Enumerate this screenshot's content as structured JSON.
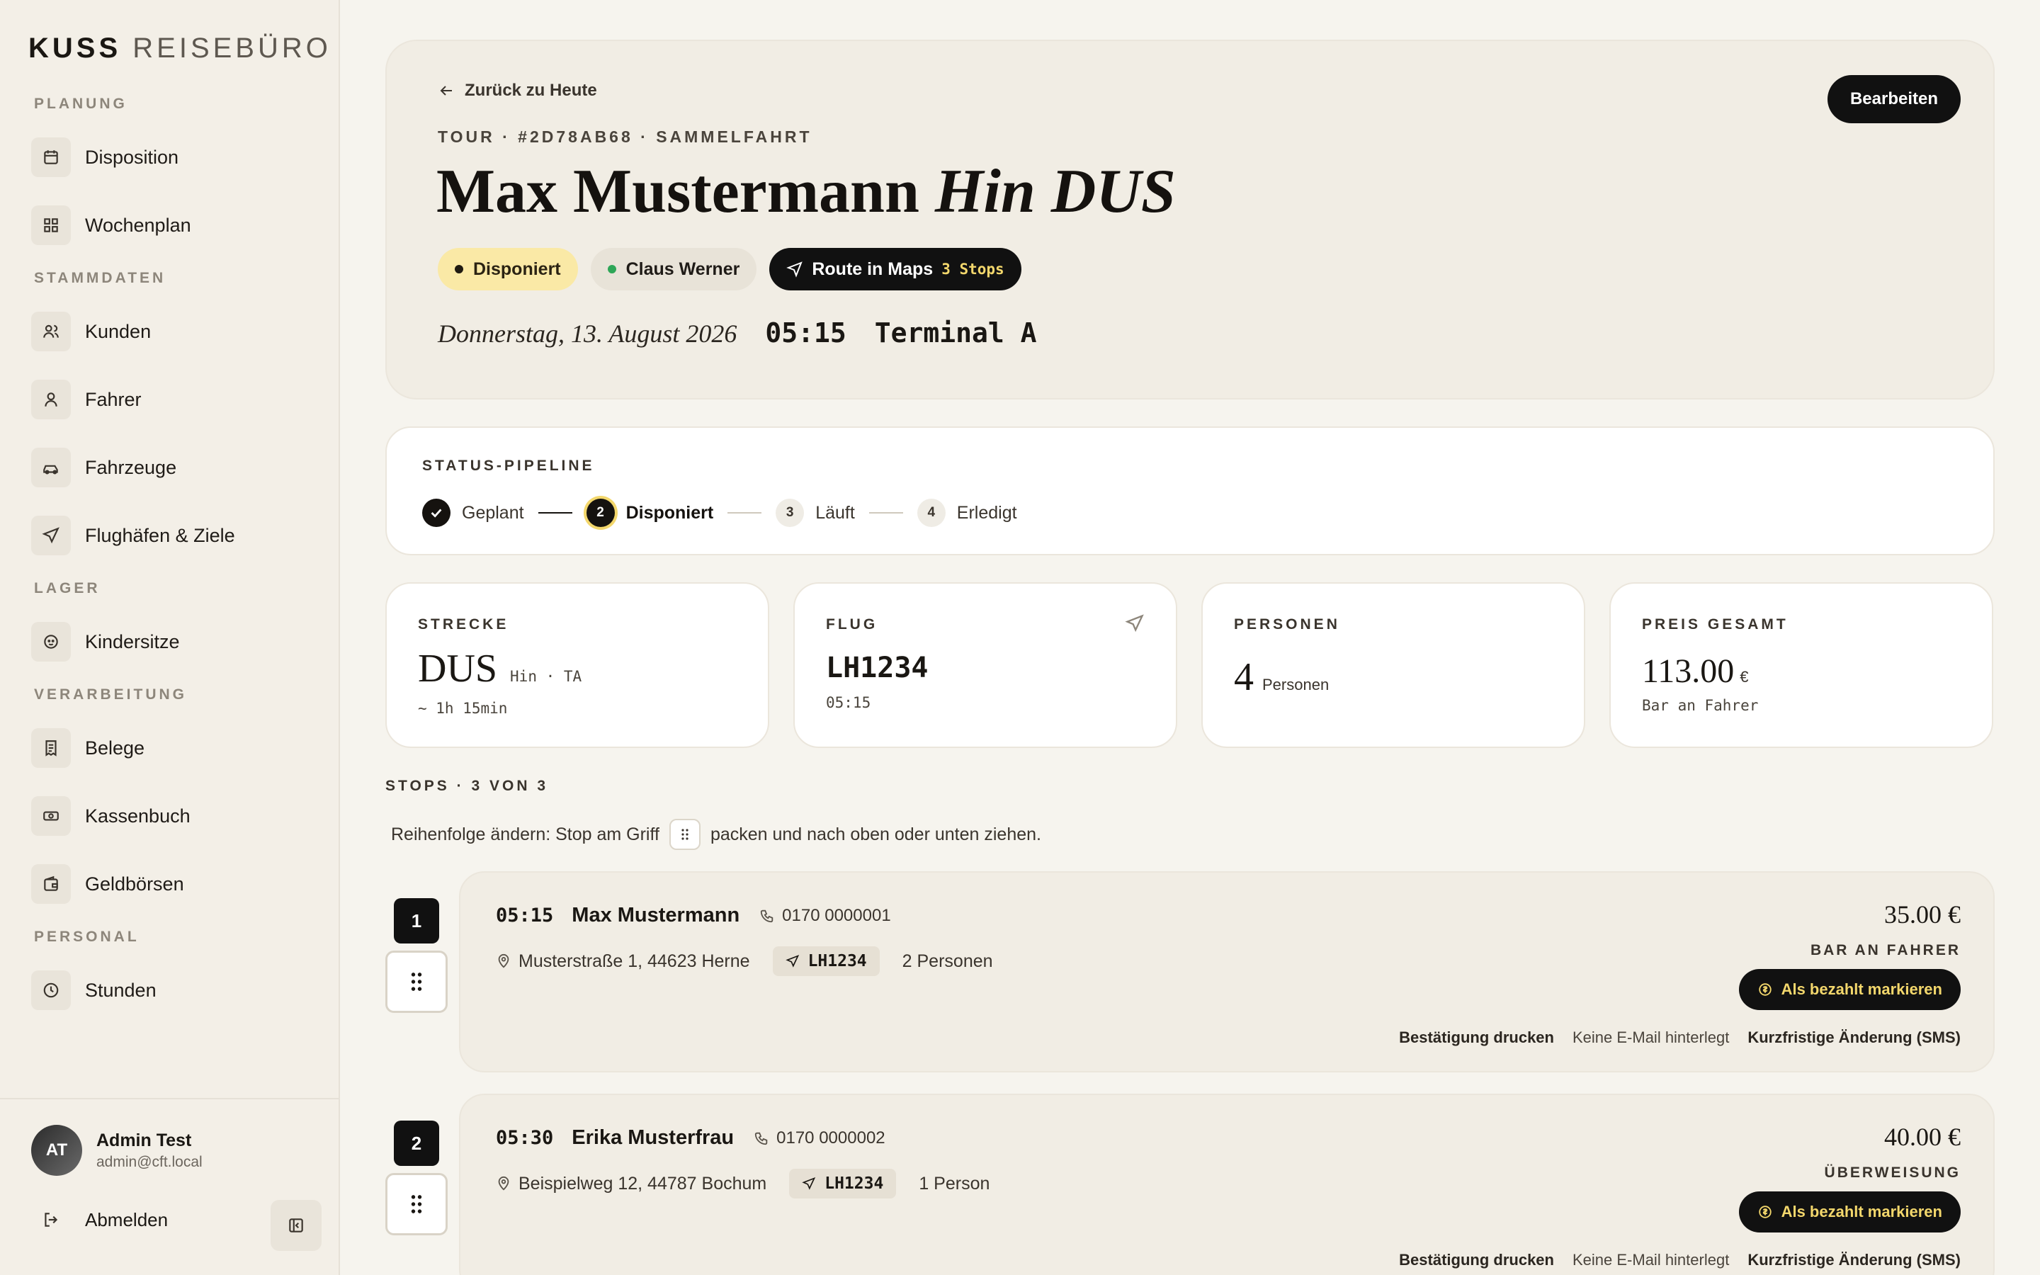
{
  "brand": {
    "bold": "KUSS",
    "light": "REISEBÜRO"
  },
  "sidebar": {
    "sections": [
      {
        "label": "PLANUNG",
        "items": [
          "Disposition",
          "Wochenplan"
        ]
      },
      {
        "label": "STAMMDATEN",
        "items": [
          "Kunden",
          "Fahrer",
          "Fahrzeuge",
          "Flughäfen & Ziele"
        ]
      },
      {
        "label": "LAGER",
        "items": [
          "Kindersitze"
        ]
      },
      {
        "label": "VERARBEITUNG",
        "items": [
          "Belege",
          "Kassenbuch",
          "Geldbörsen"
        ]
      },
      {
        "label": "PERSONAL",
        "items": [
          "Stunden"
        ]
      }
    ],
    "user": {
      "initials": "AT",
      "name": "Admin Test",
      "email": "admin@cft.local"
    },
    "logout": "Abmelden"
  },
  "hero": {
    "back": "Zurück zu Heute",
    "meta": "TOUR · #2D78AB68 · SAMMELFAHRT",
    "title_main": "Max Mustermann",
    "title_italic": "Hin DUS",
    "status_chip": "Disponiert",
    "driver_chip": "Claus Werner",
    "route_chip": "Route in Maps",
    "route_stops": "3 Stops",
    "date": "Donnerstag, 13. August 2026",
    "time": "05:15",
    "terminal": "Terminal A",
    "edit": "Bearbeiten"
  },
  "pipeline": {
    "label": "STATUS-PIPELINE",
    "steps": [
      {
        "num": "",
        "label": "Geplant"
      },
      {
        "num": "2",
        "label": "Disponiert"
      },
      {
        "num": "3",
        "label": "Läuft"
      },
      {
        "num": "4",
        "label": "Erledigt"
      }
    ]
  },
  "cards": {
    "strecke": {
      "label": "STRECKE",
      "value": "DUS",
      "tag": "Hin · TA",
      "sub": "~ 1h 15min"
    },
    "flug": {
      "label": "FLUG",
      "value": "LH1234",
      "sub": "05:15"
    },
    "personen": {
      "label": "PERSONEN",
      "value": "4",
      "unit": "Personen"
    },
    "preis": {
      "label": "PREIS GESAMT",
      "value": "113.00",
      "currency": "€",
      "sub": "Bar an Fahrer"
    }
  },
  "stops": {
    "heading": "STOPS · 3 VON 3",
    "hint_before": "Reihenfolge ändern: Stop am Griff",
    "hint_after": "packen und nach oben oder unten ziehen.",
    "list": [
      {
        "num": "1",
        "time": "05:15",
        "name": "Max Mustermann",
        "phone": "0170 0000001",
        "address": "Musterstraße 1, 44623 Herne",
        "flight": "LH1234",
        "persons": "2 Personen",
        "price": "35.00 €",
        "payment": "BAR AN FAHRER",
        "paid_btn": "Als bezahlt markieren",
        "print": "Bestätigung drucken",
        "email": "Keine E-Mail hinterlegt",
        "sms": "Kurzfristige Änderung (SMS)"
      },
      {
        "num": "2",
        "time": "05:30",
        "name": "Erika Musterfrau",
        "phone": "0170 0000002",
        "address": "Beispielweg 12, 44787 Bochum",
        "flight": "LH1234",
        "persons": "1 Person",
        "price": "40.00 €",
        "payment": "ÜBERWEISUNG",
        "paid_btn": "Als bezahlt markieren",
        "print": "Bestätigung drucken",
        "email": "Keine E-Mail hinterlegt",
        "sms": "Kurzfristige Änderung (SMS)"
      }
    ]
  }
}
